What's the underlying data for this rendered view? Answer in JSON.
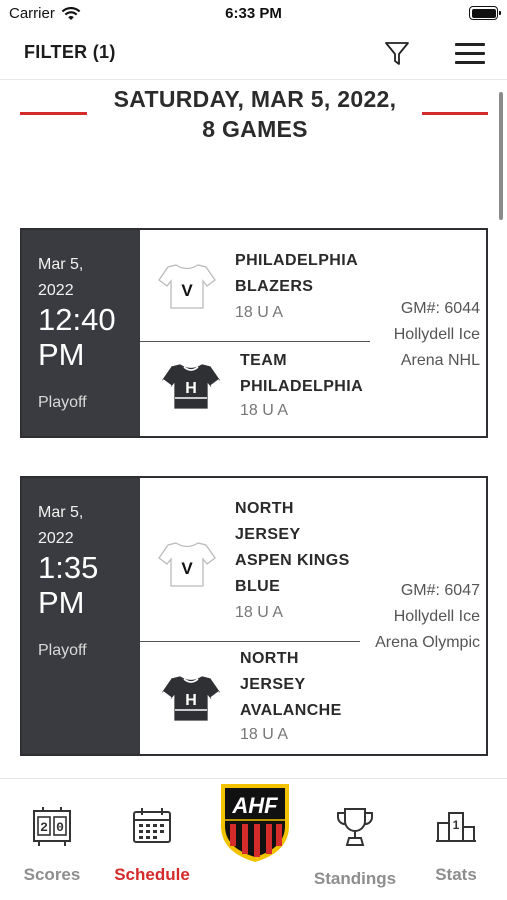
{
  "status_bar": {
    "carrier": "Carrier",
    "time": "6:33 PM"
  },
  "header": {
    "filter_label": "FILTER (1)"
  },
  "date_heading": {
    "line1": "SATURDAY, MAR 5, 2022,",
    "line2": "8 GAMES"
  },
  "games": [
    {
      "date_line1": "Mar 5,",
      "date_line2": "2022",
      "time_line1": "12:40",
      "time_line2": "PM",
      "type": "Playoff",
      "visitor": {
        "badge": "V",
        "name_lines": [
          "PHILADELPHIA",
          "BLAZERS"
        ],
        "division": "18 U A"
      },
      "home": {
        "badge": "H",
        "name_lines": [
          "TEAM",
          "PHILADELPHIA"
        ],
        "division": "18 U A"
      },
      "game_number": "GM#: 6044",
      "arena_lines": [
        "Hollydell Ice",
        "Arena NHL"
      ]
    },
    {
      "date_line1": "Mar 5,",
      "date_line2": "2022",
      "time_line1": "1:35",
      "time_line2": "PM",
      "type": "Playoff",
      "visitor": {
        "badge": "V",
        "name_lines": [
          "NORTH",
          "JERSEY",
          "ASPEN KINGS",
          "BLUE"
        ],
        "division": "18 U A"
      },
      "home": {
        "badge": "H",
        "name_lines": [
          "NORTH",
          "JERSEY",
          "AVALANCHE"
        ],
        "division": "18 U A"
      },
      "game_number": "GM#: 6047",
      "arena_lines": [
        "Hollydell Ice",
        "Arena Olympic"
      ]
    }
  ],
  "tabs": [
    {
      "label": "Scores",
      "icon": "scoreboard-icon",
      "active": false
    },
    {
      "label": "Schedule",
      "icon": "calendar-icon",
      "active": true
    },
    {
      "label": "Standings",
      "icon": "trophy-icon",
      "active": false
    },
    {
      "label": "Stats",
      "icon": "podium-icon",
      "active": false
    }
  ],
  "logo": {
    "text": "AHF"
  },
  "colors": {
    "accent": "#d42b2b",
    "panel": "#3a3b40",
    "text_muted": "#8e8e8e"
  }
}
